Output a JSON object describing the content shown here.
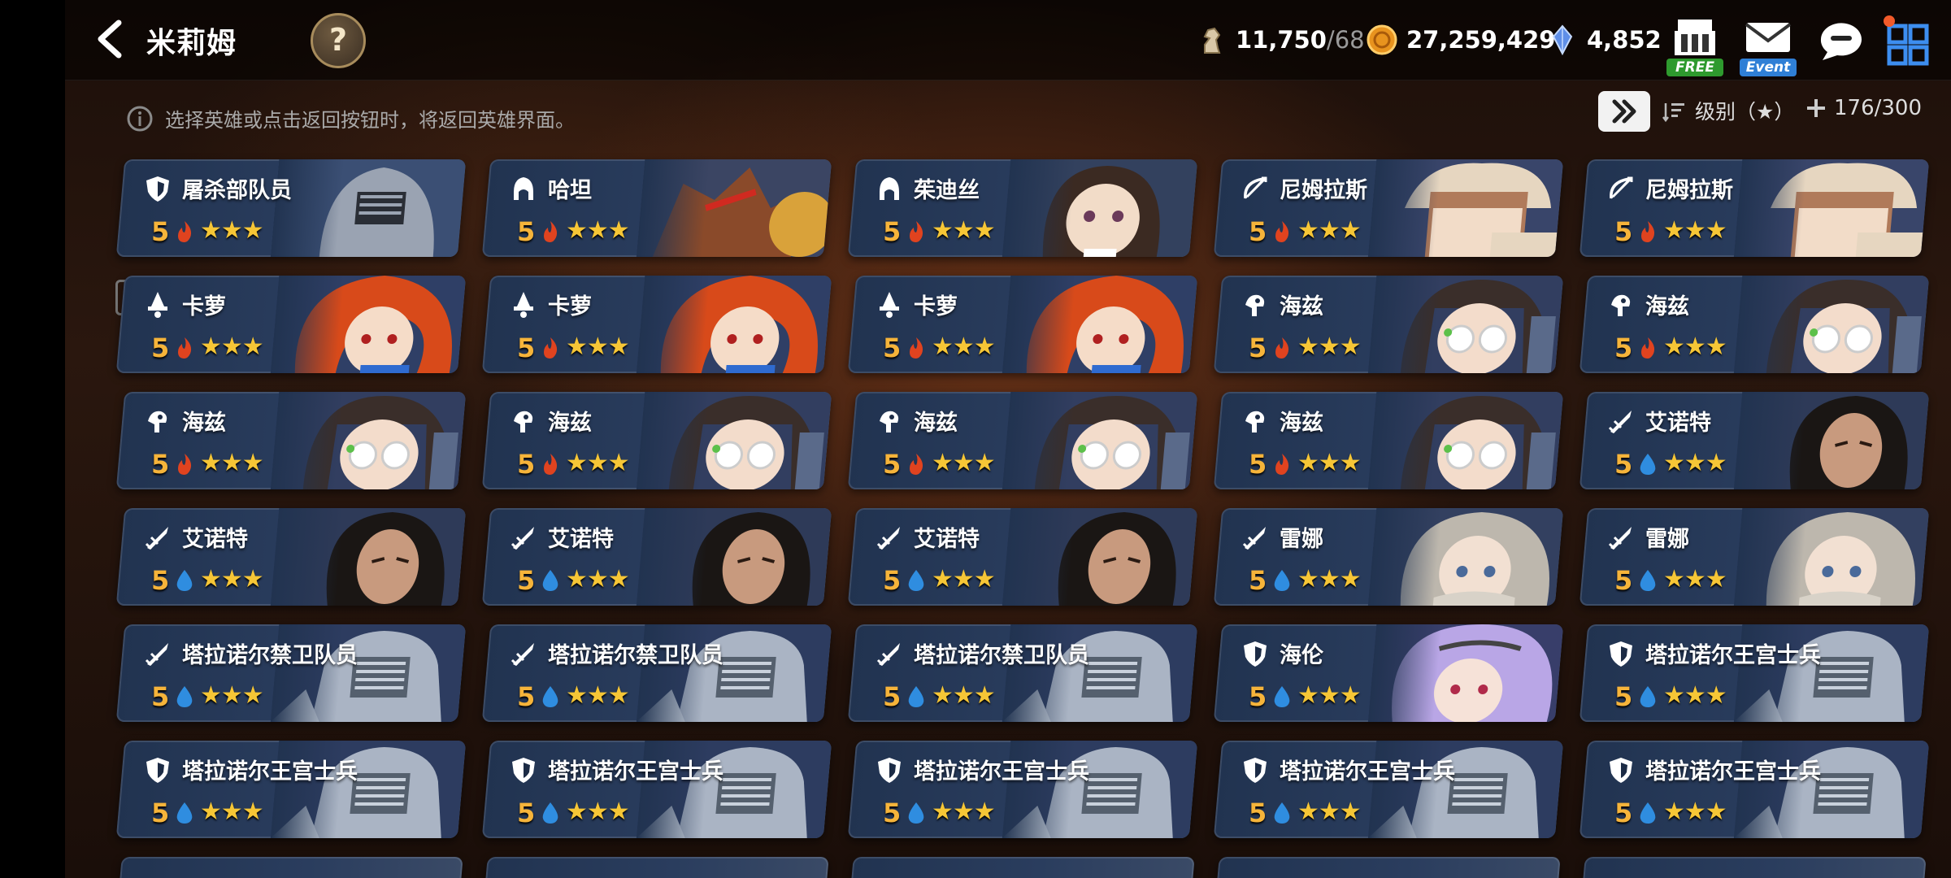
{
  "header": {
    "title": "米莉姆",
    "help_label": "?",
    "resources": {
      "stamina": {
        "value": "11,750",
        "sub": "/68"
      },
      "gold": {
        "value": "27,259,429"
      },
      "crystal": {
        "value": "4,852"
      }
    },
    "free_label": "FREE",
    "event_label": "Event"
  },
  "notice": "选择英雄或点击返回按钮时，将返回英雄界面。",
  "sort_label": "级别（★）",
  "hero_count": "176/300",
  "colors": {
    "fire": "#e0431f",
    "water": "#2f8de0",
    "level": "#f6b43a",
    "star": "#f6c636"
  },
  "heroes": [
    {
      "name": "屠杀部队员",
      "class": "shield-icon",
      "level": "5",
      "element": "fire",
      "stars": "★★★",
      "portrait": "knight"
    },
    {
      "name": "哈坦",
      "class": "hood-icon",
      "level": "5",
      "element": "fire",
      "stars": "★★★",
      "portrait": "wolf"
    },
    {
      "name": "茱迪丝",
      "class": "hood-icon",
      "level": "5",
      "element": "fire",
      "stars": "★★★",
      "portrait": "brunette"
    },
    {
      "name": "尼姆拉斯",
      "class": "bow-icon",
      "level": "5",
      "element": "fire",
      "stars": "★★★",
      "portrait": "hat"
    },
    {
      "name": "尼姆拉斯",
      "class": "bow-icon",
      "level": "5",
      "element": "fire",
      "stars": "★★★",
      "portrait": "hat"
    },
    {
      "name": "卡萝",
      "class": "mage-icon",
      "level": "5",
      "element": "fire",
      "stars": "★★★",
      "portrait": "redhair"
    },
    {
      "name": "卡萝",
      "class": "mage-icon",
      "level": "5",
      "element": "fire",
      "stars": "★★★",
      "portrait": "redhair"
    },
    {
      "name": "卡萝",
      "class": "mage-icon",
      "level": "5",
      "element": "fire",
      "stars": "★★★",
      "portrait": "redhair"
    },
    {
      "name": "海兹",
      "class": "support-icon",
      "level": "5",
      "element": "fire",
      "stars": "★★★",
      "portrait": "glasses"
    },
    {
      "name": "海兹",
      "class": "support-icon",
      "level": "5",
      "element": "fire",
      "stars": "★★★",
      "portrait": "glasses"
    },
    {
      "name": "海兹",
      "class": "support-icon",
      "level": "5",
      "element": "fire",
      "stars": "★★★",
      "portrait": "glasses"
    },
    {
      "name": "海兹",
      "class": "support-icon",
      "level": "5",
      "element": "fire",
      "stars": "★★★",
      "portrait": "glasses"
    },
    {
      "name": "海兹",
      "class": "support-icon",
      "level": "5",
      "element": "fire",
      "stars": "★★★",
      "portrait": "glasses"
    },
    {
      "name": "海兹",
      "class": "support-icon",
      "level": "5",
      "element": "fire",
      "stars": "★★★",
      "portrait": "glasses"
    },
    {
      "name": "艾诺特",
      "class": "sword-icon",
      "level": "5",
      "element": "water",
      "stars": "★★★",
      "portrait": "darkhair"
    },
    {
      "name": "艾诺特",
      "class": "sword-icon",
      "level": "5",
      "element": "water",
      "stars": "★★★",
      "portrait": "darkhair"
    },
    {
      "name": "艾诺特",
      "class": "sword-icon",
      "level": "5",
      "element": "water",
      "stars": "★★★",
      "portrait": "darkhair"
    },
    {
      "name": "艾诺特",
      "class": "sword-icon",
      "level": "5",
      "element": "water",
      "stars": "★★★",
      "portrait": "darkhair"
    },
    {
      "name": "雷娜",
      "class": "sword-icon",
      "level": "5",
      "element": "water",
      "stars": "★★★",
      "portrait": "silver"
    },
    {
      "name": "雷娜",
      "class": "sword-icon",
      "level": "5",
      "element": "water",
      "stars": "★★★",
      "portrait": "silver"
    },
    {
      "name": "塔拉诺尔禁卫队员",
      "class": "sword-icon",
      "level": "5",
      "element": "water",
      "stars": "★★★",
      "portrait": "armor"
    },
    {
      "name": "塔拉诺尔禁卫队员",
      "class": "sword-icon",
      "level": "5",
      "element": "water",
      "stars": "★★★",
      "portrait": "armor"
    },
    {
      "name": "塔拉诺尔禁卫队员",
      "class": "sword-icon",
      "level": "5",
      "element": "water",
      "stars": "★★★",
      "portrait": "armor"
    },
    {
      "name": "海伦",
      "class": "shield-icon",
      "level": "5",
      "element": "water",
      "stars": "★★★",
      "portrait": "lavender"
    },
    {
      "name": "塔拉诺尔王宫士兵",
      "class": "shield-icon",
      "level": "5",
      "element": "water",
      "stars": "★★★",
      "portrait": "armor"
    },
    {
      "name": "塔拉诺尔王宫士兵",
      "class": "shield-icon",
      "level": "5",
      "element": "water",
      "stars": "★★★",
      "portrait": "armor"
    },
    {
      "name": "塔拉诺尔王宫士兵",
      "class": "shield-icon",
      "level": "5",
      "element": "water",
      "stars": "★★★",
      "portrait": "armor"
    },
    {
      "name": "塔拉诺尔王宫士兵",
      "class": "shield-icon",
      "level": "5",
      "element": "water",
      "stars": "★★★",
      "portrait": "armor"
    },
    {
      "name": "塔拉诺尔王宫士兵",
      "class": "shield-icon",
      "level": "5",
      "element": "water",
      "stars": "★★★",
      "portrait": "armor"
    },
    {
      "name": "塔拉诺尔王宫士兵",
      "class": "shield-icon",
      "level": "5",
      "element": "water",
      "stars": "★★★",
      "portrait": "armor"
    }
  ]
}
